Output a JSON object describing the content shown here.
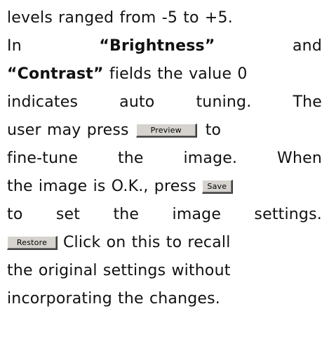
{
  "doc": {
    "l1": "levels ranged from -5 to +5.",
    "l2a": "In",
    "l2b": "“Brightness”",
    "l2c": "and",
    "l3a": "“Contrast”",
    "l3b": " fields the value 0",
    "l4a": "indicates",
    "l4b": "auto",
    "l4c": "tuning.",
    "l4d": "The",
    "l5a": "user may press",
    "l5b": "to",
    "l6a": "fine-tune",
    "l6b": "the",
    "l6c": "image.",
    "l6d": "When",
    "l7a": "the image is O.K., press",
    "l8a": "to",
    "l8b": "set",
    "l8c": "the",
    "l8d": "image",
    "l8e": "settings.",
    "l9a": "Click on this to recall",
    "l10": "the original settings without",
    "l11": "incorporating the changes."
  },
  "buttons": {
    "preview": "Preview",
    "save": "Save",
    "restore": "Restore"
  }
}
